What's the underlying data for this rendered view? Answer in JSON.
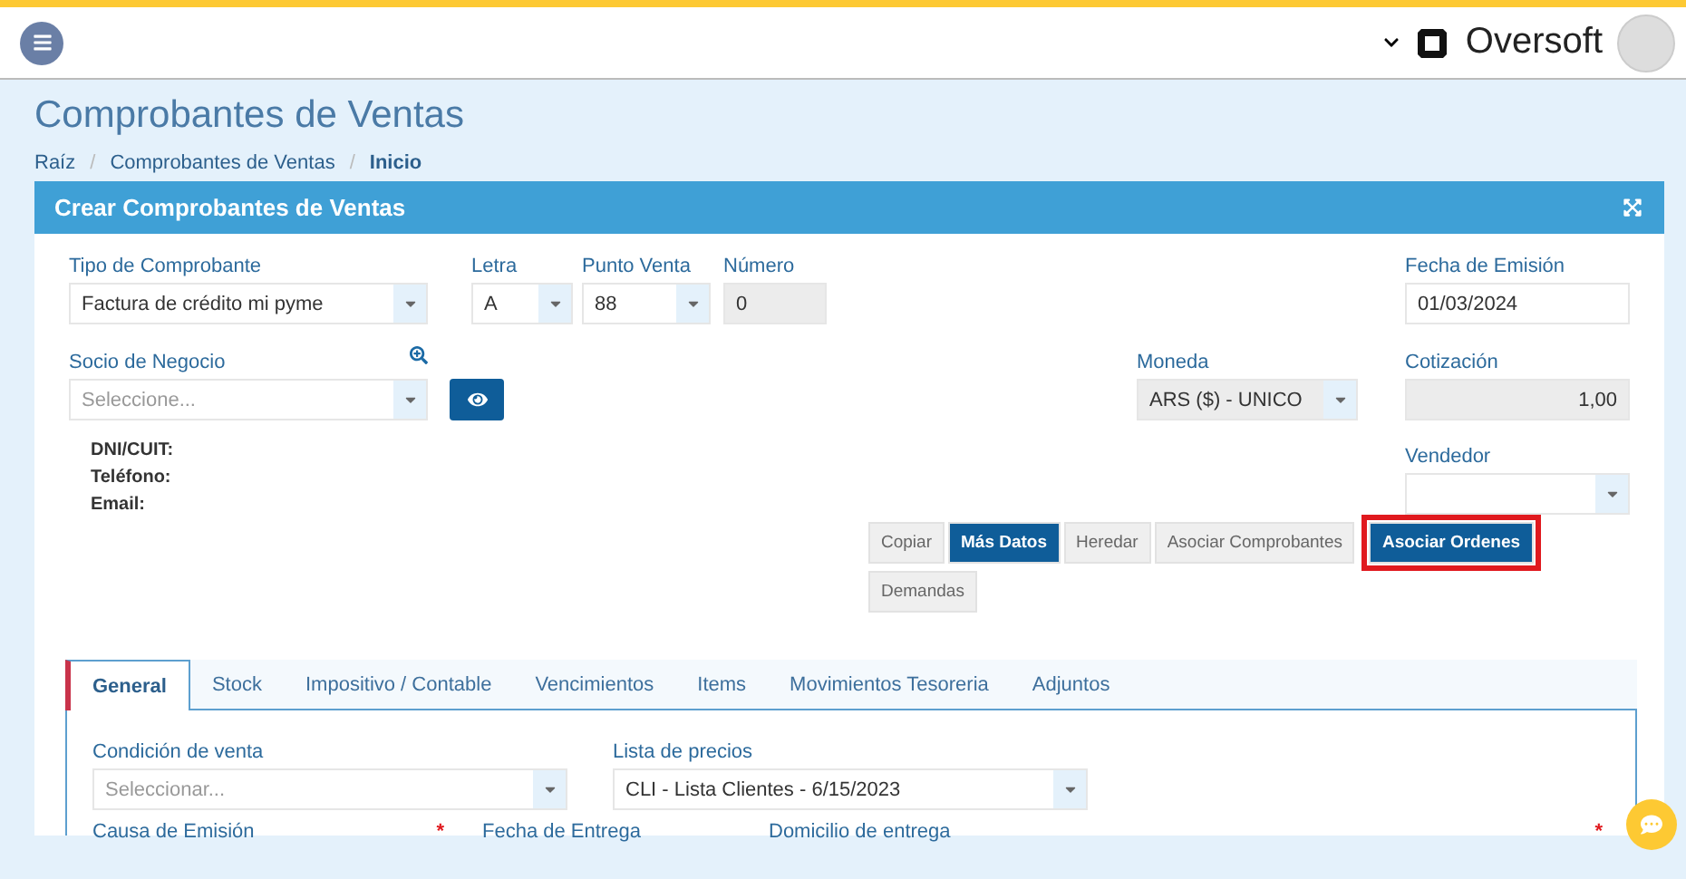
{
  "header": {
    "brand": "Oversoft"
  },
  "page": {
    "title": "Comprobantes de Ventas",
    "breadcrumb": [
      {
        "label": "Raíz",
        "current": false
      },
      {
        "label": "Comprobantes de Ventas",
        "current": false
      },
      {
        "label": "Inicio",
        "current": true
      }
    ],
    "separators": [
      "/",
      "/"
    ]
  },
  "panel": {
    "title": "Crear Comprobantes de Ventas"
  },
  "row_1": [
    {
      "label": "Tipo de Comprobante",
      "kind": "select",
      "value": "Factura de crédito mi pyme",
      "disabled": false
    },
    {
      "label": "Letra",
      "kind": "select",
      "value": "A",
      "disabled": false
    },
    {
      "label": "Punto Venta",
      "kind": "select",
      "value": "88",
      "disabled": false
    },
    {
      "label": "Número",
      "kind": "input",
      "value": "0",
      "disabled": true
    }
  ],
  "fecha_emision": {
    "label": "Fecha de Emisión",
    "value": "01/03/2024"
  },
  "socio": {
    "label": "Socio de Negocio",
    "placeholder": "Seleccione..."
  },
  "moneda": {
    "label": "Moneda",
    "value": "ARS ($) - UNICO",
    "disabled": true
  },
  "cotizacion": {
    "label": "Cotización",
    "value": "1,00",
    "disabled": true
  },
  "partner_info": [
    "DNI/CUIT:",
    "Teléfono:",
    "Email:"
  ],
  "vendedor": {
    "label": "Vendedor"
  },
  "actions": [
    {
      "label": "Copiar",
      "selected": false,
      "highlighted": false
    },
    {
      "label": "Más Datos",
      "selected": true,
      "highlighted": false
    },
    {
      "label": "Heredar",
      "selected": false,
      "highlighted": false
    },
    {
      "label": "Asociar Comprobantes",
      "selected": false,
      "highlighted": false
    },
    {
      "label": "Asociar Ordenes",
      "selected": true,
      "highlighted": true
    },
    {
      "label": "Demandas",
      "selected": false,
      "highlighted": false
    }
  ],
  "tabs": [
    {
      "label": "General",
      "selected": true
    },
    {
      "label": "Stock",
      "selected": false
    },
    {
      "label": "Impositivo / Contable",
      "selected": false
    },
    {
      "label": "Vencimientos",
      "selected": false
    },
    {
      "label": "Items",
      "selected": false
    },
    {
      "label": "Movimientos Tesoreria",
      "selected": false
    },
    {
      "label": "Adjuntos",
      "selected": false
    }
  ],
  "general": {
    "condicion": {
      "label": "Condición de venta",
      "placeholder": "Seleccionar..."
    },
    "lista": {
      "label": "Lista de precios",
      "value": "CLI - Lista Clientes - 6/15/2023"
    },
    "row_labels": [
      {
        "label": "Causa de Emisión",
        "required": true
      },
      {
        "label": "Fecha de Entrega",
        "required": false
      },
      {
        "label": "Domicilio de entrega",
        "required": true
      }
    ],
    "required_mark": "*"
  }
}
